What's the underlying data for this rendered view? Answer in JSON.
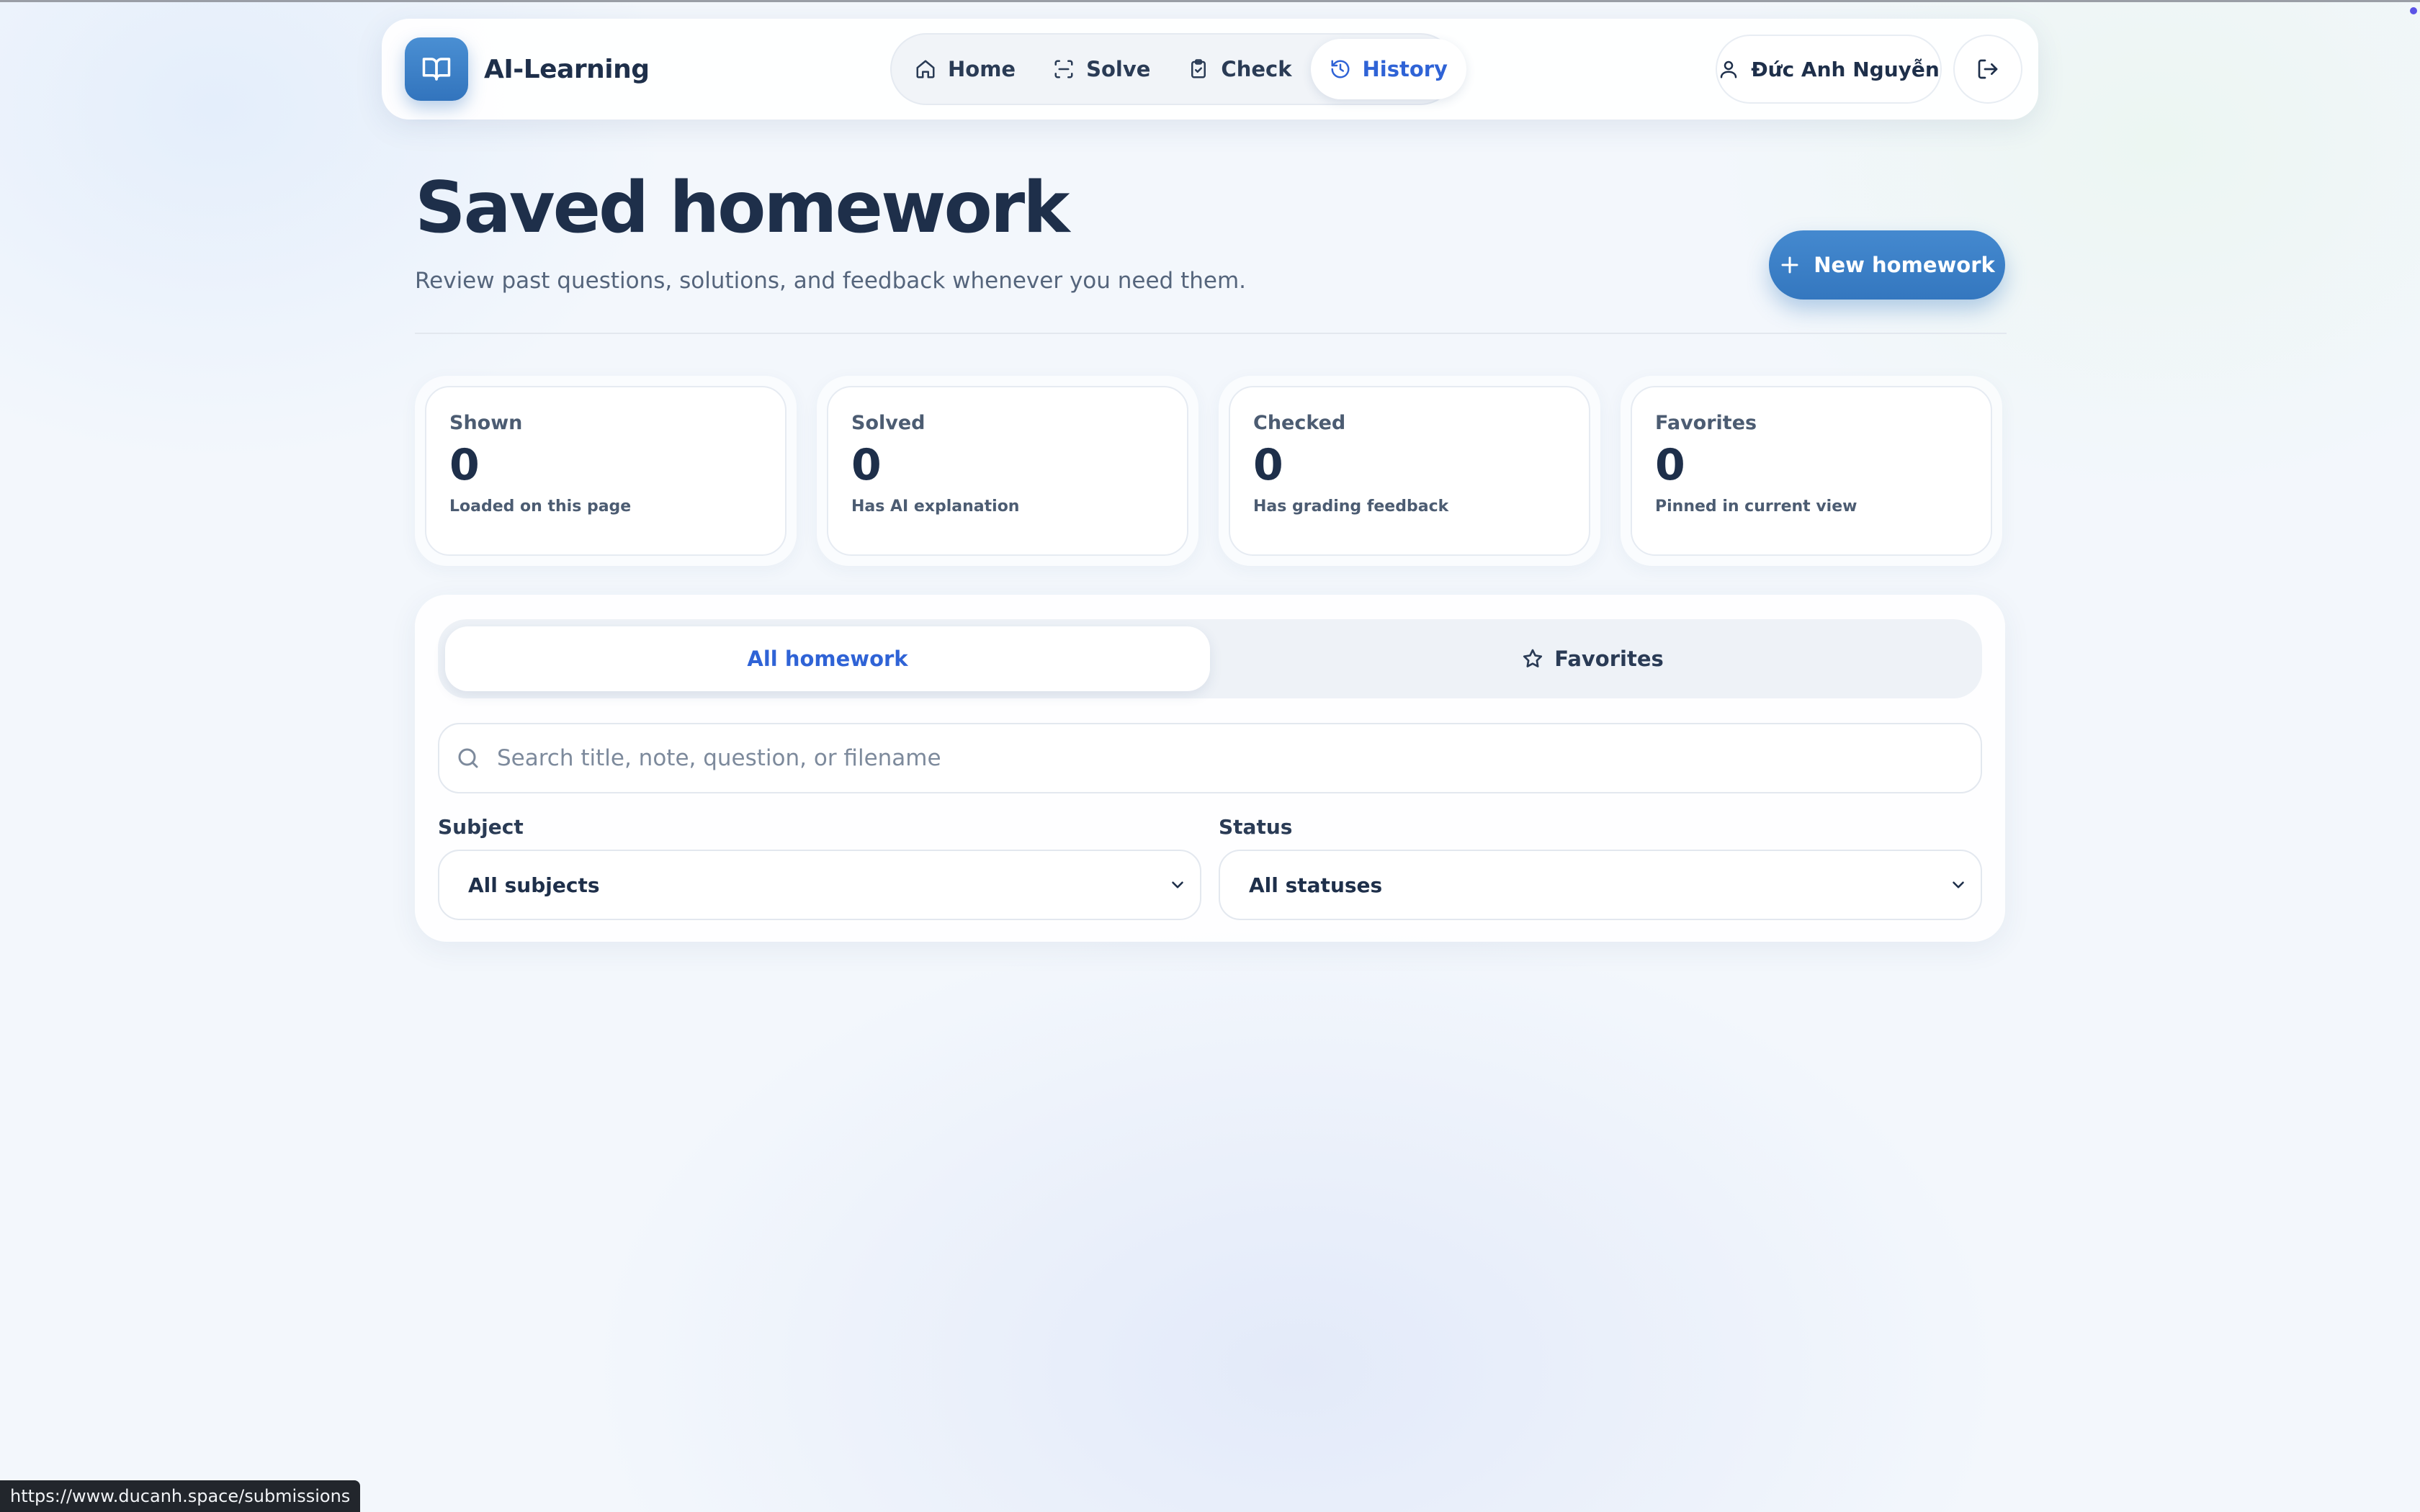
{
  "app": {
    "name": "AI-Learning",
    "accent_color": "#3477bf",
    "active_color": "#2f63d6"
  },
  "nav": {
    "items": [
      {
        "label": "Home",
        "icon": "home-icon"
      },
      {
        "label": "Solve",
        "icon": "scan-icon"
      },
      {
        "label": "Check",
        "icon": "clipboard-check-icon"
      },
      {
        "label": "History",
        "icon": "history-icon",
        "active": true
      }
    ],
    "user_name": "Đức Anh Nguyễn",
    "user_icon": "user-icon",
    "logout_icon": "logout-icon"
  },
  "header": {
    "title": "Saved homework",
    "subtitle": "Review past questions, solutions, and feedback whenever you need them.",
    "new_button_label": "New homework",
    "new_button_icon": "plus-icon"
  },
  "stats": [
    {
      "label": "Shown",
      "value": "0",
      "sub": "Loaded on this page"
    },
    {
      "label": "Solved",
      "value": "0",
      "sub": "Has AI explanation"
    },
    {
      "label": "Checked",
      "value": "0",
      "sub": "Has grading feedback"
    },
    {
      "label": "Favorites",
      "value": "0",
      "sub": "Pinned in current view"
    }
  ],
  "filters": {
    "tabs": [
      {
        "label": "All homework",
        "active": true
      },
      {
        "label": "Favorites",
        "icon": "star-icon"
      }
    ],
    "search_placeholder": "Search title, note, question, or filename",
    "search_value": "",
    "subject_label": "Subject",
    "subject_value": "All subjects",
    "status_label": "Status",
    "status_value": "All statuses"
  },
  "status_bar": {
    "url": "https://www.ducanh.space/submissions"
  }
}
